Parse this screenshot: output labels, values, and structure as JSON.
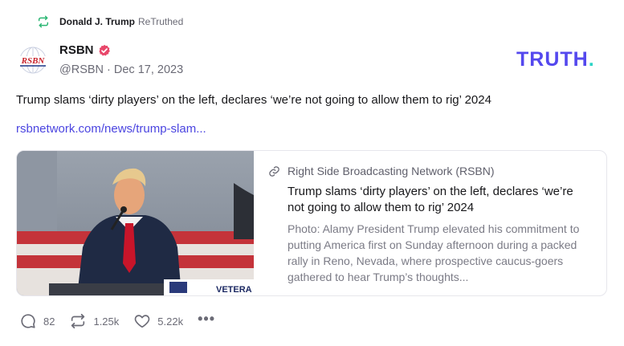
{
  "retruth": {
    "user": "Donald J. Trump",
    "label": "ReTruthed",
    "icon": "retruth-icon"
  },
  "author": {
    "name": "RSBN",
    "handle_date": "@RSBN · Dec 17, 2023",
    "avatar_text": "RSBN",
    "verified_icon": "verified-badge-icon"
  },
  "brand": {
    "text": "TRUTH",
    "dot": ".",
    "color": "#5448ee",
    "dot_color": "#2bd4c6"
  },
  "post": {
    "text": "Trump slams ‘dirty players’ on the left, declares ‘we’re not going to allow them to rig’ 2024",
    "link": "rsbnetwork.com/news/trump-slam..."
  },
  "card": {
    "site": "Right Side Broadcasting Network (RSBN)",
    "title": "Trump slams ‘dirty players’ on the left, declares ‘we’re not going to allow them to rig’ 2024",
    "description": "Photo: Alamy President Trump elevated his commitment to putting America first on Sunday afternoon during a packed rally in Reno, Nevada, where prospective caucus-goers gathered to hear Trump’s thoughts...",
    "image_sign_text": "VETERA"
  },
  "actions": {
    "replies": "82",
    "retruths": "1.25k",
    "likes": "5.22k",
    "more": "•••"
  }
}
